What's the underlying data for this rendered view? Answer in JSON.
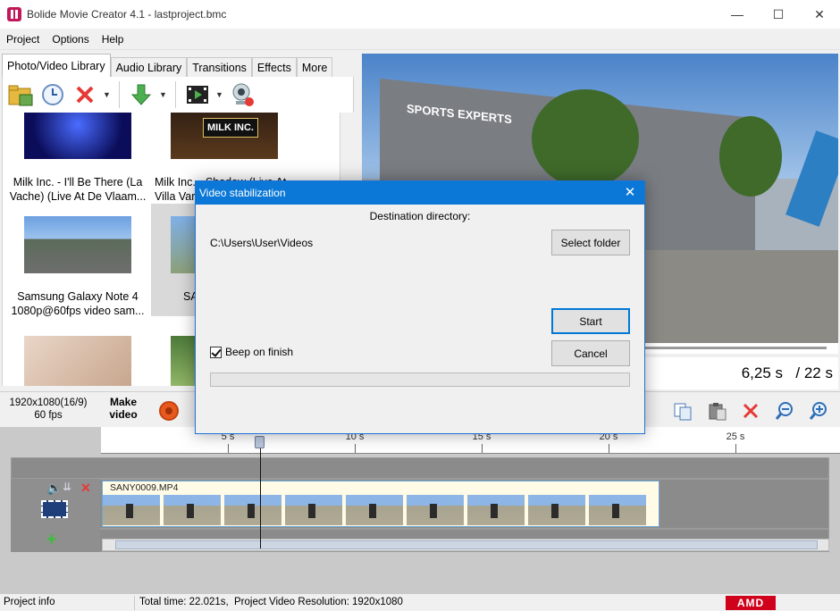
{
  "window": {
    "title": "Bolide Movie Creator 4.1 - lastproject.bmc"
  },
  "menu": [
    "Project",
    "Options",
    "Help"
  ],
  "tabs": [
    "Photo/Video Library",
    "Audio Library",
    "Transitions",
    "Effects",
    "More"
  ],
  "library": {
    "items": [
      {
        "label1": "",
        "label2": ""
      },
      {
        "label1": "",
        "label2": ""
      },
      {
        "label1": "Milk Inc.  - I'll Be There (La",
        "label2": "Vache) (Live At De Vlaam..."
      },
      {
        "label1": "Milk Inc. - Shadow (Live At",
        "label2": "Villa Var"
      },
      {
        "label1": "Samsung Galaxy Note 4",
        "label2": "1080p@60fps video sam..."
      },
      {
        "label1": "SA",
        "label2": ""
      }
    ],
    "thumb_text": "MILK INC."
  },
  "preview": {
    "current_time": "6,25 s",
    "total_time": "/ 22 s",
    "sign_text": "SPORTS EXPERTS"
  },
  "export": {
    "resolution": "1920x1080(16/9)",
    "fps": "60 fps",
    "make_video_1": "Make",
    "make_video_2": "video"
  },
  "timeline": {
    "ticks": [
      "5 s",
      "10 s",
      "15 s",
      "20 s",
      "25 s"
    ],
    "clip_name": "SANY0009.MP4"
  },
  "dialog": {
    "title": "Video stabilization",
    "heading": "Destination directory:",
    "path": "C:\\Users\\User\\Videos",
    "select_folder": "Select folder",
    "start": "Start",
    "cancel": "Cancel",
    "beep_label": "Beep on finish",
    "beep_checked": true,
    "progress": 0
  },
  "status": {
    "project_info": "Project info",
    "total_time": "Total time: 22.021s,",
    "resolution_label": "Project Video Resolution:",
    "resolution_value": "1920x1080",
    "amd": "AMD"
  }
}
